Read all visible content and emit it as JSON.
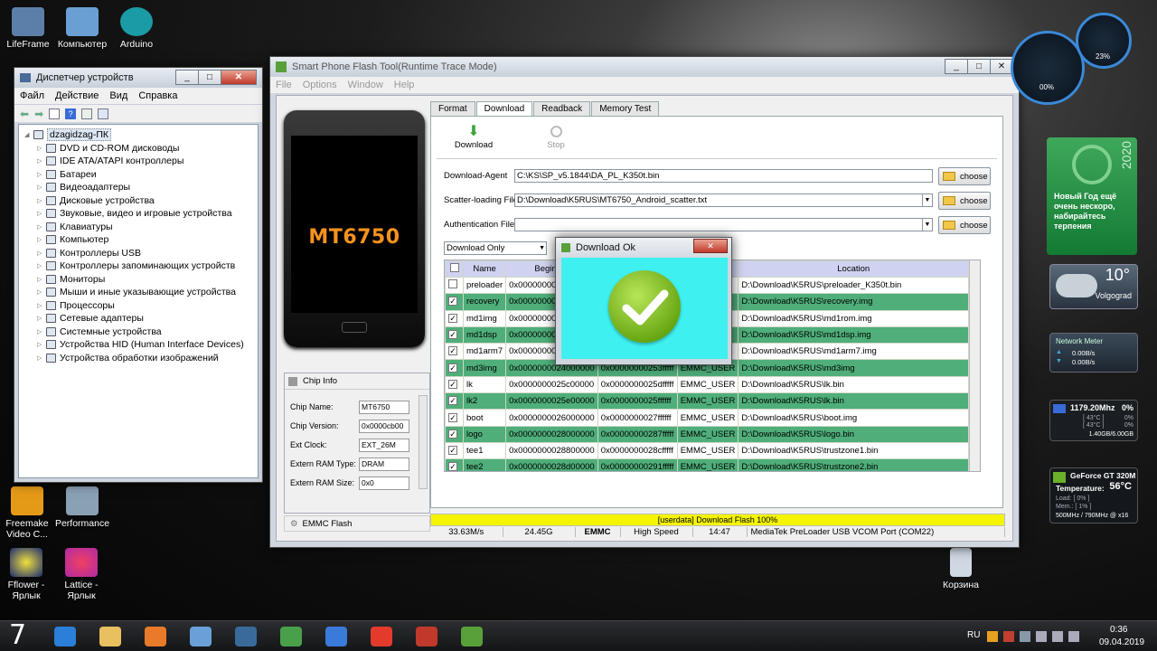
{
  "desktop": {
    "icons": [
      {
        "label": "LifeFrame",
        "color": "#5b7fa8"
      },
      {
        "label": "Компьютер",
        "color": "#6a9fd4"
      },
      {
        "label": "Arduino",
        "color": "#1b9ba6"
      },
      {
        "label": "Freemake Video C...",
        "color": "#e59a17"
      },
      {
        "label": "Performance",
        "color": "#8aa0b4"
      },
      {
        "label": "Fflower - Ярлык",
        "color": "#1b2a6e"
      },
      {
        "label": "Lattice - Ярлык",
        "color": "#b02aa6"
      },
      {
        "label": "Корзина",
        "color": "#cfd8e3"
      }
    ]
  },
  "device_manager": {
    "title": "Диспетчер устройств",
    "menu": [
      "Файл",
      "Действие",
      "Вид",
      "Справка"
    ],
    "root": "dzagidzag-ПК",
    "items": [
      "DVD и CD-ROM дисководы",
      "IDE ATA/ATAPI контроллеры",
      "Батареи",
      "Видеоадаптеры",
      "Дисковые устройства",
      "Звуковые, видео и игровые устройства",
      "Клавиатуры",
      "Компьютер",
      "Контроллеры USB",
      "Контроллеры запоминающих устройств",
      "Мониторы",
      "Мыши и иные указывающие устройства",
      "Процессоры",
      "Сетевые адаптеры",
      "Системные устройства",
      "Устройства HID (Human Interface Devices)",
      "Устройства обработки изображений"
    ]
  },
  "flash_tool": {
    "title": "Smart Phone Flash Tool(Runtime Trace Mode)",
    "menu": [
      "File",
      "Options",
      "Window",
      "Help"
    ],
    "phone_label": "MT6750",
    "tabs": [
      "Format",
      "Download",
      "Readback",
      "Memory Test"
    ],
    "active_tab": "Download",
    "actions": {
      "download": "Download",
      "stop": "Stop"
    },
    "download_agent_label": "Download-Agent",
    "download_agent_value": "C:\\KS\\SP_v5.1844\\DA_PL_K350t.bin",
    "scatter_label": "Scatter-loading File",
    "scatter_value": "D:\\Download\\K5RUS\\MT6750_Android_scatter.txt",
    "auth_label": "Authentication File",
    "auth_value": "",
    "choose_label": "choose",
    "mode_value": "Download Only",
    "columns": [
      "Name",
      "Begin Ad",
      "",
      "",
      "Location"
    ],
    "rows": [
      {
        "checked": false,
        "name": "preloader",
        "begin": "0x000000000",
        "end": "",
        "region": "",
        "location": "D:\\Download\\K5RUS\\preloader_K350t.bin"
      },
      {
        "checked": true,
        "name": "recovery",
        "begin": "0x000000000",
        "end": "",
        "region": "",
        "location": "D:\\Download\\K5RUS\\recovery.img"
      },
      {
        "checked": true,
        "name": "md1img",
        "begin": "0x000000002",
        "end": "",
        "region": "",
        "location": "D:\\Download\\K5RUS\\md1rom.img"
      },
      {
        "checked": true,
        "name": "md1dsp",
        "begin": "0x000000002",
        "end": "",
        "region": "",
        "location": "D:\\Download\\K5RUS\\md1dsp.img"
      },
      {
        "checked": true,
        "name": "md1arm7",
        "begin": "0x000000002",
        "end": "",
        "region": "",
        "location": "D:\\Download\\K5RUS\\md1arm7.img"
      },
      {
        "checked": true,
        "name": "md3img",
        "begin": "0x0000000024000000",
        "end": "0x00000000253fffff",
        "region": "EMMC_USER",
        "location": "D:\\Download\\K5RUS\\md3img"
      },
      {
        "checked": true,
        "name": "lk",
        "begin": "0x0000000025c00000",
        "end": "0x0000000025dfffff",
        "region": "EMMC_USER",
        "location": "D:\\Download\\K5RUS\\lk.bin"
      },
      {
        "checked": true,
        "name": "lk2",
        "begin": "0x0000000025e00000",
        "end": "0x0000000025ffffff",
        "region": "EMMC_USER",
        "location": "D:\\Download\\K5RUS\\lk.bin"
      },
      {
        "checked": true,
        "name": "boot",
        "begin": "0x0000000026000000",
        "end": "0x0000000027ffffff",
        "region": "EMMC_USER",
        "location": "D:\\Download\\K5RUS\\boot.img"
      },
      {
        "checked": true,
        "name": "logo",
        "begin": "0x0000000028000000",
        "end": "0x00000000287fffff",
        "region": "EMMC_USER",
        "location": "D:\\Download\\K5RUS\\logo.bin"
      },
      {
        "checked": true,
        "name": "tee1",
        "begin": "0x0000000028800000",
        "end": "0x0000000028cfffff",
        "region": "EMMC_USER",
        "location": "D:\\Download\\K5RUS\\trustzone1.bin"
      },
      {
        "checked": true,
        "name": "tee2",
        "begin": "0x0000000028d00000",
        "end": "0x00000000291fffff",
        "region": "EMMC_USER",
        "location": "D:\\Download\\K5RUS\\trustzone2.bin"
      }
    ],
    "chip_info_title": "Chip Info",
    "chip_info": [
      {
        "label": "Chip Name:",
        "value": "MT6750"
      },
      {
        "label": "Chip Version:",
        "value": "0x0000cb00"
      },
      {
        "label": "Ext Clock:",
        "value": "EXT_26M"
      },
      {
        "label": "Extern RAM Type:",
        "value": "DRAM"
      },
      {
        "label": "Extern RAM Size:",
        "value": "0x0"
      }
    ],
    "emmc_flash_label": "EMMC Flash",
    "progress_text": "[userdata] Download Flash 100%",
    "progress": 1.0,
    "status": [
      "33.63M/s",
      "24.45G",
      "EMMC",
      "High Speed",
      "14:47",
      "MediaTek PreLoader USB VCOM Port (COM22)"
    ]
  },
  "dialog": {
    "title": "Download Ok",
    "close": "✕"
  },
  "gadgets": {
    "speed_left": "00%",
    "speed_right": "23%",
    "green_year": "2020",
    "green_text": "Новый Год ещё очень нескоро, набирайтесь терпения",
    "weather_temp": "10°",
    "weather_city": "Volgograd",
    "net_title": "Network Meter",
    "net_up": "0.00B/s",
    "net_down": "0.00B/s",
    "cpu_freq": "1179.20Mhz",
    "cpu_pct": "0%",
    "cpu_core1_temp": "[ 43°C ]",
    "cpu_core1_pct": "0%",
    "cpu_core2_temp": "[ 43°C ]",
    "cpu_core2_pct": "0%",
    "cpu_mem": "1.40GB/6.00GB",
    "gpu_title": "GeForce GT 320M",
    "gpu_temp_label": "Temperature:",
    "gpu_temp": "56°C",
    "gpu_load": "Load: [ 0% ]",
    "gpu_mem": "Mem.: [ 1% ]",
    "gpu_clock": "500MHz / 790MHz @ x16"
  },
  "taskbar": {
    "start": "7",
    "lang": "RU",
    "time": "0:36",
    "date": "09.04.2019",
    "apps": [
      {
        "name": "ie-icon",
        "color": "#2a7fd8"
      },
      {
        "name": "explorer-icon",
        "color": "#e8c060"
      },
      {
        "name": "media-player-icon",
        "color": "#e87a2a"
      },
      {
        "name": "paint-icon",
        "color": "#6aa0d8"
      },
      {
        "name": "browser-icon",
        "color": "#3a6a9a"
      },
      {
        "name": "usb-tool-icon",
        "color": "#4aa04a"
      },
      {
        "name": "network-icon",
        "color": "#3a7ad8"
      },
      {
        "name": "yandex-icon",
        "color": "#e23b2c"
      },
      {
        "name": "toolbox-icon",
        "color": "#c0392b"
      },
      {
        "name": "flashtool-icon",
        "color": "#5aa03a"
      }
    ]
  }
}
